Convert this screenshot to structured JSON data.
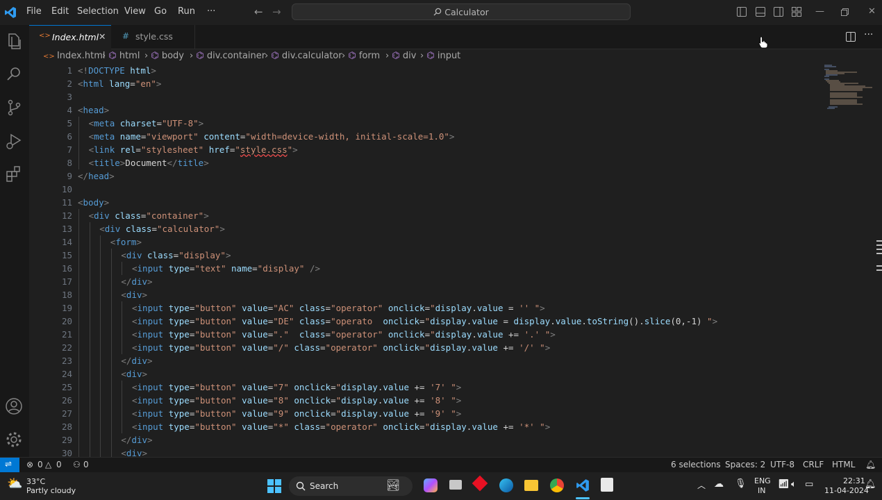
{
  "menu": [
    "File",
    "Edit",
    "Selection",
    "View",
    "Go",
    "Run",
    "···"
  ],
  "command_center": {
    "label": "Calculator"
  },
  "tabs": [
    {
      "label": "Index.html",
      "active": true,
      "icon": "html-file-icon"
    },
    {
      "label": "style.css",
      "active": false,
      "icon": "css-file-icon"
    }
  ],
  "breadcrumb": [
    "Index.html",
    "html",
    "body",
    "div.container",
    "div.calculator",
    "form",
    "div",
    "input"
  ],
  "lines": [
    {
      "n": 1,
      "indent": 0,
      "t": [
        [
          "tg",
          "<!"
        ],
        [
          "tn",
          "DOCTYPE"
        ],
        [
          "tx",
          " "
        ],
        [
          "an",
          "html"
        ],
        [
          "tg",
          ">"
        ]
      ]
    },
    {
      "n": 2,
      "indent": 0,
      "t": [
        [
          "tg",
          "<"
        ],
        [
          "tn",
          "html"
        ],
        [
          "tx",
          " "
        ],
        [
          "an",
          "lang"
        ],
        [
          "tx",
          "="
        ],
        [
          "av",
          "\"en\""
        ],
        [
          "tg",
          ">"
        ]
      ]
    },
    {
      "n": 3,
      "indent": 0,
      "t": []
    },
    {
      "n": 4,
      "indent": 0,
      "t": [
        [
          "tg",
          "<"
        ],
        [
          "tn",
          "head"
        ],
        [
          "tg",
          ">"
        ]
      ]
    },
    {
      "n": 5,
      "indent": 1,
      "t": [
        [
          "tg",
          "<"
        ],
        [
          "tn",
          "meta"
        ],
        [
          "tx",
          " "
        ],
        [
          "an",
          "charset"
        ],
        [
          "tx",
          "="
        ],
        [
          "av",
          "\"UTF-8\""
        ],
        [
          "tg",
          ">"
        ]
      ]
    },
    {
      "n": 6,
      "indent": 1,
      "t": [
        [
          "tg",
          "<"
        ],
        [
          "tn",
          "meta"
        ],
        [
          "tx",
          " "
        ],
        [
          "an",
          "name"
        ],
        [
          "tx",
          "="
        ],
        [
          "av",
          "\"viewport\""
        ],
        [
          "tx",
          " "
        ],
        [
          "an",
          "content"
        ],
        [
          "tx",
          "="
        ],
        [
          "av",
          "\"width=device-width, initial-scale=1.0\""
        ],
        [
          "tg",
          ">"
        ]
      ]
    },
    {
      "n": 7,
      "indent": 1,
      "t": [
        [
          "tg",
          "<"
        ],
        [
          "tn",
          "link"
        ],
        [
          "tx",
          " "
        ],
        [
          "an",
          "rel"
        ],
        [
          "tx",
          "="
        ],
        [
          "av",
          "\"stylesheet\""
        ],
        [
          "tx",
          " "
        ],
        [
          "an",
          "href"
        ],
        [
          "tx",
          "="
        ],
        [
          "av",
          "\""
        ],
        [
          "avs",
          "style.css"
        ],
        [
          "av",
          "\""
        ],
        [
          "tg",
          ">"
        ]
      ]
    },
    {
      "n": 8,
      "indent": 1,
      "t": [
        [
          "tg",
          "<"
        ],
        [
          "tn",
          "title"
        ],
        [
          "tg",
          ">"
        ],
        [
          "tx",
          "Document"
        ],
        [
          "tg",
          "</"
        ],
        [
          "tn",
          "title"
        ],
        [
          "tg",
          ">"
        ]
      ]
    },
    {
      "n": 9,
      "indent": 0,
      "t": [
        [
          "tg",
          "</"
        ],
        [
          "tn",
          "head"
        ],
        [
          "tg",
          ">"
        ]
      ]
    },
    {
      "n": 10,
      "indent": 0,
      "t": []
    },
    {
      "n": 11,
      "indent": 0,
      "t": [
        [
          "tg",
          "<"
        ],
        [
          "tn",
          "body"
        ],
        [
          "tg",
          ">"
        ]
      ]
    },
    {
      "n": 12,
      "indent": 1,
      "t": [
        [
          "tg",
          "<"
        ],
        [
          "tn",
          "div"
        ],
        [
          "tx",
          " "
        ],
        [
          "an",
          "class"
        ],
        [
          "tx",
          "="
        ],
        [
          "av",
          "\"container\""
        ],
        [
          "tg",
          ">"
        ]
      ]
    },
    {
      "n": 13,
      "indent": 2,
      "t": [
        [
          "tg",
          "<"
        ],
        [
          "tn",
          "div"
        ],
        [
          "tx",
          " "
        ],
        [
          "an",
          "class"
        ],
        [
          "tx",
          "="
        ],
        [
          "av",
          "\"calculator\""
        ],
        [
          "tg",
          ">"
        ]
      ]
    },
    {
      "n": 14,
      "indent": 3,
      "t": [
        [
          "tg",
          "<"
        ],
        [
          "tn",
          "form"
        ],
        [
          "tg",
          ">"
        ]
      ]
    },
    {
      "n": 15,
      "indent": 4,
      "t": [
        [
          "tg",
          "<"
        ],
        [
          "tn",
          "div"
        ],
        [
          "tx",
          " "
        ],
        [
          "an",
          "class"
        ],
        [
          "tx",
          "="
        ],
        [
          "av",
          "\"display\""
        ],
        [
          "tg",
          ">"
        ]
      ]
    },
    {
      "n": 16,
      "indent": 5,
      "t": [
        [
          "tg",
          "<"
        ],
        [
          "tn",
          "input"
        ],
        [
          "tx",
          " "
        ],
        [
          "an",
          "type"
        ],
        [
          "tx",
          "="
        ],
        [
          "av",
          "\"text\""
        ],
        [
          "tx",
          " "
        ],
        [
          "an",
          "name"
        ],
        [
          "tx",
          "="
        ],
        [
          "av",
          "\"display\""
        ],
        [
          "tx",
          " "
        ],
        [
          "tg",
          "/>"
        ]
      ]
    },
    {
      "n": 17,
      "indent": 4,
      "t": [
        [
          "tg",
          "</"
        ],
        [
          "tn",
          "div"
        ],
        [
          "tg",
          ">"
        ]
      ]
    },
    {
      "n": 18,
      "indent": 4,
      "t": [
        [
          "tg",
          "<"
        ],
        [
          "tn",
          "div"
        ],
        [
          "tg",
          ">"
        ]
      ]
    },
    {
      "n": 19,
      "indent": 5,
      "t": [
        [
          "tg",
          "<"
        ],
        [
          "tn",
          "input"
        ],
        [
          "tx",
          " "
        ],
        [
          "an",
          "type"
        ],
        [
          "tx",
          "="
        ],
        [
          "av",
          "\"button\""
        ],
        [
          "tx",
          " "
        ],
        [
          "an",
          "value"
        ],
        [
          "tx",
          "="
        ],
        [
          "av",
          "\"AC\""
        ],
        [
          "tx",
          " "
        ],
        [
          "an",
          "class"
        ],
        [
          "tx",
          "="
        ],
        [
          "av",
          "\"operator\""
        ],
        [
          "tx",
          " "
        ],
        [
          "an",
          "onclick"
        ],
        [
          "tx",
          "="
        ],
        [
          "av",
          "\""
        ],
        [
          "an",
          "display"
        ],
        [
          "tx",
          "."
        ],
        [
          "an",
          "value"
        ],
        [
          "tx",
          " = "
        ],
        [
          "av",
          "'' \""
        ],
        [
          "tg",
          ">"
        ]
      ]
    },
    {
      "n": 20,
      "indent": 5,
      "t": [
        [
          "tg",
          "<"
        ],
        [
          "tn",
          "input"
        ],
        [
          "tx",
          " "
        ],
        [
          "an",
          "type"
        ],
        [
          "tx",
          "="
        ],
        [
          "av",
          "\"button\""
        ],
        [
          "tx",
          " "
        ],
        [
          "an",
          "value"
        ],
        [
          "tx",
          "="
        ],
        [
          "av",
          "\"DE\""
        ],
        [
          "tx",
          " "
        ],
        [
          "an",
          "class"
        ],
        [
          "tx",
          "="
        ],
        [
          "av",
          "\"operato  "
        ],
        [
          "an",
          "onclick"
        ],
        [
          "tx",
          "="
        ],
        [
          "av",
          "\""
        ],
        [
          "an",
          "display"
        ],
        [
          "tx",
          "."
        ],
        [
          "an",
          "value"
        ],
        [
          "tx",
          " = "
        ],
        [
          "an",
          "display"
        ],
        [
          "tx",
          "."
        ],
        [
          "an",
          "value"
        ],
        [
          "tx",
          "."
        ],
        [
          "an",
          "toString"
        ],
        [
          "tx",
          "()."
        ],
        [
          "an",
          "slice"
        ],
        [
          "tx",
          "(0,-1) "
        ],
        [
          "av",
          "\""
        ],
        [
          "tg",
          ">"
        ]
      ]
    },
    {
      "n": 21,
      "indent": 5,
      "t": [
        [
          "tg",
          "<"
        ],
        [
          "tn",
          "input"
        ],
        [
          "tx",
          " "
        ],
        [
          "an",
          "type"
        ],
        [
          "tx",
          "="
        ],
        [
          "av",
          "\"button\""
        ],
        [
          "tx",
          " "
        ],
        [
          "an",
          "value"
        ],
        [
          "tx",
          "="
        ],
        [
          "av",
          "\".\""
        ],
        [
          "tx",
          "  "
        ],
        [
          "an",
          "class"
        ],
        [
          "tx",
          "="
        ],
        [
          "av",
          "\"operator\""
        ],
        [
          "tx",
          " "
        ],
        [
          "an",
          "onclick"
        ],
        [
          "tx",
          "="
        ],
        [
          "av",
          "\""
        ],
        [
          "an",
          "display"
        ],
        [
          "tx",
          "."
        ],
        [
          "an",
          "value"
        ],
        [
          "tx",
          " += "
        ],
        [
          "av",
          "'.' \""
        ],
        [
          "tg",
          ">"
        ]
      ]
    },
    {
      "n": 22,
      "indent": 5,
      "t": [
        [
          "tg",
          "<"
        ],
        [
          "tn",
          "input"
        ],
        [
          "tx",
          " "
        ],
        [
          "an",
          "type"
        ],
        [
          "tx",
          "="
        ],
        [
          "av",
          "\"button\""
        ],
        [
          "tx",
          " "
        ],
        [
          "an",
          "value"
        ],
        [
          "tx",
          "="
        ],
        [
          "av",
          "\"/\""
        ],
        [
          "tx",
          " "
        ],
        [
          "an",
          "class"
        ],
        [
          "tx",
          "="
        ],
        [
          "av",
          "\"operator\""
        ],
        [
          "tx",
          " "
        ],
        [
          "an",
          "onclick"
        ],
        [
          "tx",
          "="
        ],
        [
          "av",
          "\""
        ],
        [
          "an",
          "display"
        ],
        [
          "tx",
          "."
        ],
        [
          "an",
          "value"
        ],
        [
          "tx",
          " += "
        ],
        [
          "av",
          "'/' \""
        ],
        [
          "tg",
          ">"
        ]
      ]
    },
    {
      "n": 23,
      "indent": 4,
      "t": [
        [
          "tg",
          "</"
        ],
        [
          "tn",
          "div"
        ],
        [
          "tg",
          ">"
        ]
      ]
    },
    {
      "n": 24,
      "indent": 4,
      "t": [
        [
          "tg",
          "<"
        ],
        [
          "tn",
          "div"
        ],
        [
          "tg",
          ">"
        ]
      ]
    },
    {
      "n": 25,
      "indent": 5,
      "t": [
        [
          "tg",
          "<"
        ],
        [
          "tn",
          "input"
        ],
        [
          "tx",
          " "
        ],
        [
          "an",
          "type"
        ],
        [
          "tx",
          "="
        ],
        [
          "av",
          "\"button\""
        ],
        [
          "tx",
          " "
        ],
        [
          "an",
          "value"
        ],
        [
          "tx",
          "="
        ],
        [
          "av",
          "\"7\""
        ],
        [
          "tx",
          " "
        ],
        [
          "an",
          "onclick"
        ],
        [
          "tx",
          "="
        ],
        [
          "av",
          "\""
        ],
        [
          "an",
          "display"
        ],
        [
          "tx",
          "."
        ],
        [
          "an",
          "value"
        ],
        [
          "tx",
          " += "
        ],
        [
          "av",
          "'7' \""
        ],
        [
          "tg",
          ">"
        ]
      ]
    },
    {
      "n": 26,
      "indent": 5,
      "t": [
        [
          "tg",
          "<"
        ],
        [
          "tn",
          "input"
        ],
        [
          "tx",
          " "
        ],
        [
          "an",
          "type"
        ],
        [
          "tx",
          "="
        ],
        [
          "av",
          "\"button\""
        ],
        [
          "tx",
          " "
        ],
        [
          "an",
          "value"
        ],
        [
          "tx",
          "="
        ],
        [
          "av",
          "\"8\""
        ],
        [
          "tx",
          " "
        ],
        [
          "an",
          "onclick"
        ],
        [
          "tx",
          "="
        ],
        [
          "av",
          "\""
        ],
        [
          "an",
          "display"
        ],
        [
          "tx",
          "."
        ],
        [
          "an",
          "value"
        ],
        [
          "tx",
          " += "
        ],
        [
          "av",
          "'8' \""
        ],
        [
          "tg",
          ">"
        ]
      ]
    },
    {
      "n": 27,
      "indent": 5,
      "t": [
        [
          "tg",
          "<"
        ],
        [
          "tn",
          "input"
        ],
        [
          "tx",
          " "
        ],
        [
          "an",
          "type"
        ],
        [
          "tx",
          "="
        ],
        [
          "av",
          "\"button\""
        ],
        [
          "tx",
          " "
        ],
        [
          "an",
          "value"
        ],
        [
          "tx",
          "="
        ],
        [
          "av",
          "\"9\""
        ],
        [
          "tx",
          " "
        ],
        [
          "an",
          "onclick"
        ],
        [
          "tx",
          "="
        ],
        [
          "av",
          "\""
        ],
        [
          "an",
          "display"
        ],
        [
          "tx",
          "."
        ],
        [
          "an",
          "value"
        ],
        [
          "tx",
          " += "
        ],
        [
          "av",
          "'9' \""
        ],
        [
          "tg",
          ">"
        ]
      ]
    },
    {
      "n": 28,
      "indent": 5,
      "t": [
        [
          "tg",
          "<"
        ],
        [
          "tn",
          "input"
        ],
        [
          "tx",
          " "
        ],
        [
          "an",
          "type"
        ],
        [
          "tx",
          "="
        ],
        [
          "av",
          "\"button\""
        ],
        [
          "tx",
          " "
        ],
        [
          "an",
          "value"
        ],
        [
          "tx",
          "="
        ],
        [
          "av",
          "\"*\""
        ],
        [
          "tx",
          " "
        ],
        [
          "an",
          "class"
        ],
        [
          "tx",
          "="
        ],
        [
          "av",
          "\"operator\""
        ],
        [
          "tx",
          " "
        ],
        [
          "an",
          "onclick"
        ],
        [
          "tx",
          "="
        ],
        [
          "av",
          "\""
        ],
        [
          "an",
          "display"
        ],
        [
          "tx",
          "."
        ],
        [
          "an",
          "value"
        ],
        [
          "tx",
          " += "
        ],
        [
          "av",
          "'*' \""
        ],
        [
          "tg",
          ">"
        ]
      ]
    },
    {
      "n": 29,
      "indent": 4,
      "t": [
        [
          "tg",
          "</"
        ],
        [
          "tn",
          "div"
        ],
        [
          "tg",
          ">"
        ]
      ]
    },
    {
      "n": 30,
      "indent": 4,
      "t": [
        [
          "tg",
          "<"
        ],
        [
          "tn",
          "div"
        ],
        [
          "tg",
          ">"
        ]
      ]
    }
  ],
  "status": {
    "errors": "0",
    "warnings": "0",
    "ports": "0",
    "selections": "6 selections",
    "spaces": "Spaces: 2",
    "encoding": "UTF-8",
    "eol": "CRLF",
    "language": "HTML"
  },
  "taskbar": {
    "weather_temp": "33°C",
    "weather_desc": "Partly cloudy",
    "search": "Search",
    "lang_top": "ENG",
    "lang_bottom": "IN",
    "time": "22:31",
    "date": "11-04-2024"
  }
}
